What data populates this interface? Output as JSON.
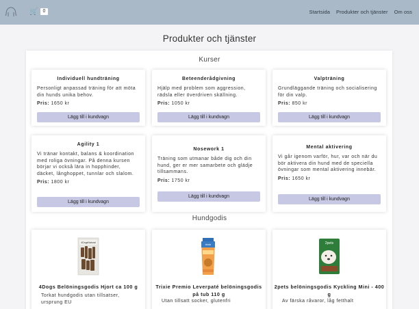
{
  "header": {
    "cart_count": "0",
    "nav": [
      "Startsida",
      "Produkter och tjänster",
      "Om oss"
    ]
  },
  "page_title": "Produkter och tjänster",
  "courses": {
    "title": "Kurser",
    "items": [
      {
        "name": "Individuell hundträning",
        "desc": "Personligt anpassad träning för att möta din hunds unika behov.",
        "price_label": "Pris:",
        "price": "1650 kr",
        "button": "Lägg till i kundvagn"
      },
      {
        "name": "Beteenderådgivning",
        "desc": "Hjälp med problem som aggression, rädsla eller överdriven skällning.",
        "price_label": "Pris:",
        "price": "1050 kr",
        "button": "Lägg till i kundvagn"
      },
      {
        "name": "Valpträning",
        "desc": "Grundläggande träning och socialisering för din valp.",
        "price_label": "Pris:",
        "price": "850 kr",
        "button": "Lägg till i kundvagn"
      },
      {
        "name": "Agility 1",
        "desc": "Vi tränar kontakt, balans & koordination med roliga övningar. På denna kursen börjar vi också lära in hopphinder, däcket, långhoppet, tunnlar och slalom.",
        "price_label": "Pris:",
        "price": "1800 kr",
        "button": "Lägg till i kundvagn"
      },
      {
        "name": "Nosework 1",
        "desc": "Träning som utmanar både dig och din hund, ger er mer samarbete och glädje tillsammans.",
        "price_label": "Pris:",
        "price": "1750 kr",
        "button": "Lägg till i kundvagn"
      },
      {
        "name": "Mental aktivering",
        "desc": "Vi går igenom varför, hur, var och när du bör aktivera din hund med de speciella övningar som mental aktivering innebär.",
        "price_label": "Pris:",
        "price": "1650 kr",
        "button": "Lägg till i kundvagn"
      }
    ]
  },
  "treats": {
    "title": "Hundgodis",
    "items": [
      {
        "name": "4Dogs Belöningsgodis Hjort ca 100 g",
        "desc": "Torkat hundgodis utan tillsatser, ursprung EU"
      },
      {
        "name": "Trixie Premio Leverpaté belöningsgodis på tub 110 g",
        "desc": "Utan tillsatt socker, glutenfri"
      },
      {
        "name": "2pets belöningsgodis Kyckling Mini - 400 g",
        "desc": "Av färska råvaror, låg fetthalt"
      }
    ]
  }
}
